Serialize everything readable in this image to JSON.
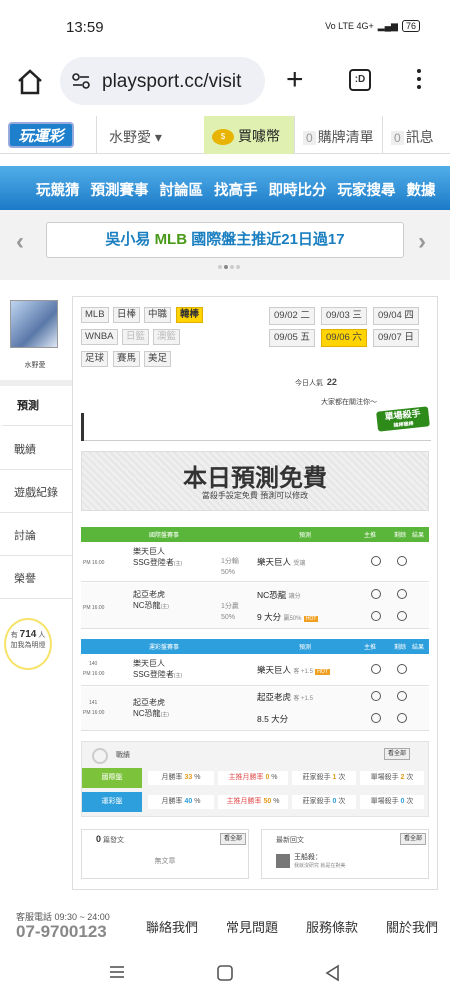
{
  "status": {
    "time": "13:59",
    "battery": "76",
    "signal": "Vo LTE 4G+"
  },
  "browser": {
    "url": "playsport.cc/visit",
    "tabs_count": ":D"
  },
  "header": {
    "logo": "玩運彩",
    "user": "水野愛 ▾",
    "coin": "買噱幣",
    "cart_count": "0",
    "cart": "購牌清單",
    "msg_count": "0",
    "msg": "訊息"
  },
  "nav": [
    "玩競猜",
    "預測賽事",
    "討論區",
    "找高手",
    "即時比分",
    "玩家搜尋",
    "數據"
  ],
  "banner": {
    "pre": "吳小易 ",
    "highlight": "MLB",
    "post": " 國際盤主推近21日過17"
  },
  "sidebar": {
    "username": "水野愛",
    "items": [
      "預測",
      "戰績",
      "遊戲紀錄",
      "討論",
      "榮譽"
    ],
    "bulb_pre": "有",
    "bulb_count": "714",
    "bulb_unit": "人",
    "bulb_post": "加我為明燈"
  },
  "leagues": {
    "row1": [
      "MLB",
      "日棒",
      "中職",
      "韓棒"
    ],
    "row2": [
      "WNBA",
      "日籃",
      "澳籃"
    ],
    "row3": [
      "足球",
      "賽馬",
      "美足"
    ]
  },
  "dates": [
    "09/02 二",
    "09/03 三",
    "09/04 四",
    "09/05 五",
    "09/06 六",
    "09/07 日"
  ],
  "popularity": {
    "label": "今日人氣",
    "value": "22",
    "watching": "大家都在關注你～"
  },
  "killer": {
    "title": "單場殺手",
    "sub": "韓棒職棒"
  },
  "free": {
    "title": "本日預測免費",
    "subtitle": "當殺手設定免費 預測可以修改"
  },
  "table_green": {
    "headers": [
      "國際盤賽事",
      "預測",
      "主推",
      "剩餘",
      "結果"
    ],
    "games": [
      {
        "time": "PM 16:00",
        "away": "樂天巨人",
        "home": "SSG登陸者",
        "home_tag": "(主)",
        "line": "1分輸",
        "pct": "50%",
        "pick": "樂天巨人",
        "pick_note": "受讓",
        "extra": null
      },
      {
        "time": "PM 16:00",
        "away": "起亞老虎",
        "home": "NC恐龍",
        "home_tag": "(主)",
        "line": "1分贏",
        "pct": "50%",
        "pick": "NC恐龍",
        "pick_note": "讓分",
        "pick2": "9 大分",
        "pick2_note": "贏50%"
      }
    ]
  },
  "table_blue": {
    "headers": [
      "運彩盤賽事",
      "預測",
      "主推",
      "剩餘",
      "結果"
    ],
    "games": [
      {
        "num": "140",
        "time": "PM 16:00",
        "away": "樂天巨人",
        "home": "SSG登陸者",
        "home_tag": "(主)",
        "pick": "樂天巨人",
        "pick_note": "客 +1.5"
      },
      {
        "num": "141",
        "time": "PM 16:00",
        "away": "起亞老虎",
        "home": "NC恐龍",
        "home_tag": "(主)",
        "pick": "起亞老虎",
        "pick_note": "客 +1.5",
        "pick2": "8.5 大分"
      }
    ]
  },
  "summary": {
    "title": "戰績",
    "more": "看全部",
    "rows": [
      {
        "label": "國際盤",
        "c1": "月勝率",
        "v1": "33",
        "c2": "主推月勝率",
        "v2": "0",
        "c3": "莊家殺手",
        "v3": "1",
        "c4": "單場殺手",
        "v4": "2",
        "color": "#7cc23a"
      },
      {
        "label": "運彩盤",
        "c1": "月勝率",
        "v1": "40",
        "c2": "主推月勝率",
        "v2": "50",
        "c3": "莊家殺手",
        "v3": "0",
        "c4": "單場殺手",
        "v4": "0",
        "color": "#2d9fdc"
      }
    ]
  },
  "posts": {
    "count": "0",
    "label": "篇發文",
    "empty": "無文章",
    "more": "看全部"
  },
  "replies": {
    "label": "最新回文",
    "more": "看全部",
    "user": "王船殺：",
    "text": "我就沒研究 就是在對美"
  },
  "footer": {
    "service": "客服電話 09:30 ~ 24:00",
    "phone": "07-9700123",
    "links": [
      "聯絡我們",
      "常見問題",
      "服務條款",
      "關於我們"
    ]
  }
}
